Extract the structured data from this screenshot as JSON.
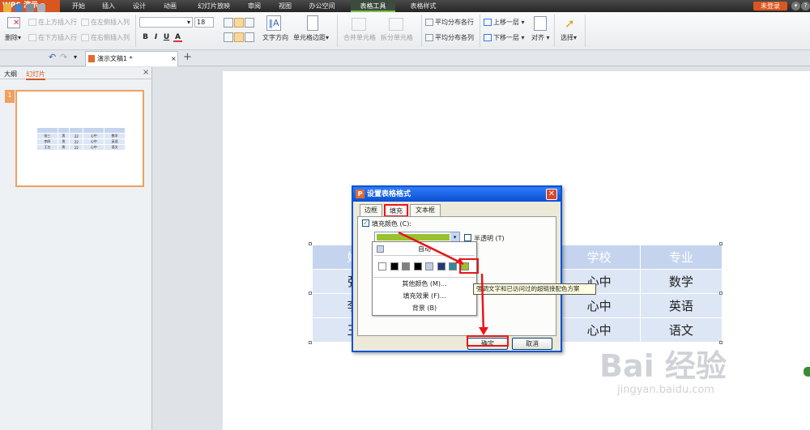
{
  "app": {
    "name": "WPS 演示",
    "login": "未登录"
  },
  "menu_tabs": [
    "开始",
    "插入",
    "设计",
    "动画",
    "幻灯片放映",
    "审阅",
    "视图",
    "办公空间",
    "表格工具",
    "表格样式"
  ],
  "ribbon": {
    "delete": "删除",
    "insert_above": "在上方插入行",
    "insert_left": "在左侧插入列",
    "insert_below": "在下方插入行",
    "insert_right": "在右侧插入列",
    "font_size": "18",
    "text_dir": "文字方向",
    "cell_margin": "单元格边距",
    "merge": "合并单元格",
    "split": "拆分单元格",
    "dist_rows": "平均分布各行",
    "dist_cols": "平均分布各列",
    "bring_forward": "上移一层",
    "send_backward": "下移一层",
    "align": "对齐",
    "select": "选择",
    "fmt": [
      "B",
      "I",
      "U",
      "A"
    ]
  },
  "doc_tab": {
    "name": "演示文稿1",
    "modified": "*",
    "add": "+"
  },
  "left_panel": {
    "tabs": [
      "大纲",
      "幻灯片"
    ],
    "slide_number": "1",
    "close": "×"
  },
  "table": {
    "rows": [
      [
        "姓",
        "",
        "",
        "学校",
        "专业"
      ],
      [
        "张",
        "",
        "",
        "心中",
        "数学"
      ],
      [
        "李",
        "",
        "",
        "心中",
        "英语"
      ],
      [
        "王",
        "",
        "",
        "心中",
        "语文"
      ]
    ]
  },
  "thumb_table": {
    "rows": [
      [
        "",
        "",
        "",
        "",
        ""
      ],
      [
        "张三",
        "男",
        "22",
        "心中",
        "数学"
      ],
      [
        "李四",
        "男",
        "22",
        "心中",
        "英语"
      ],
      [
        "王五",
        "男",
        "22",
        "心中",
        "语文"
      ]
    ]
  },
  "dialog": {
    "title": "设置表格格式",
    "tabs": [
      "边框",
      "填充",
      "文本框"
    ],
    "fill_color_label": "填充颜色 (C):",
    "transparent_label": "半透明 (T)",
    "auto": "自动",
    "more_colors": "其他颜色 (M)...",
    "fill_effects": "填充效果 (F)...",
    "background": "背景 (B)",
    "ok": "确定",
    "cancel": "取消",
    "tooltip": "强调文字和已访问过的超链接配色方案",
    "selected_color": "#99c22e",
    "swatches": [
      "#ffffff",
      "#000000",
      "#808080",
      "#000000",
      "#c0cbe0",
      "#1f3a78",
      "#2e8c9c",
      "#99c22e"
    ]
  },
  "watermark": {
    "line1": "Bai 经验",
    "line2": "jingyan.baidu.com"
  }
}
